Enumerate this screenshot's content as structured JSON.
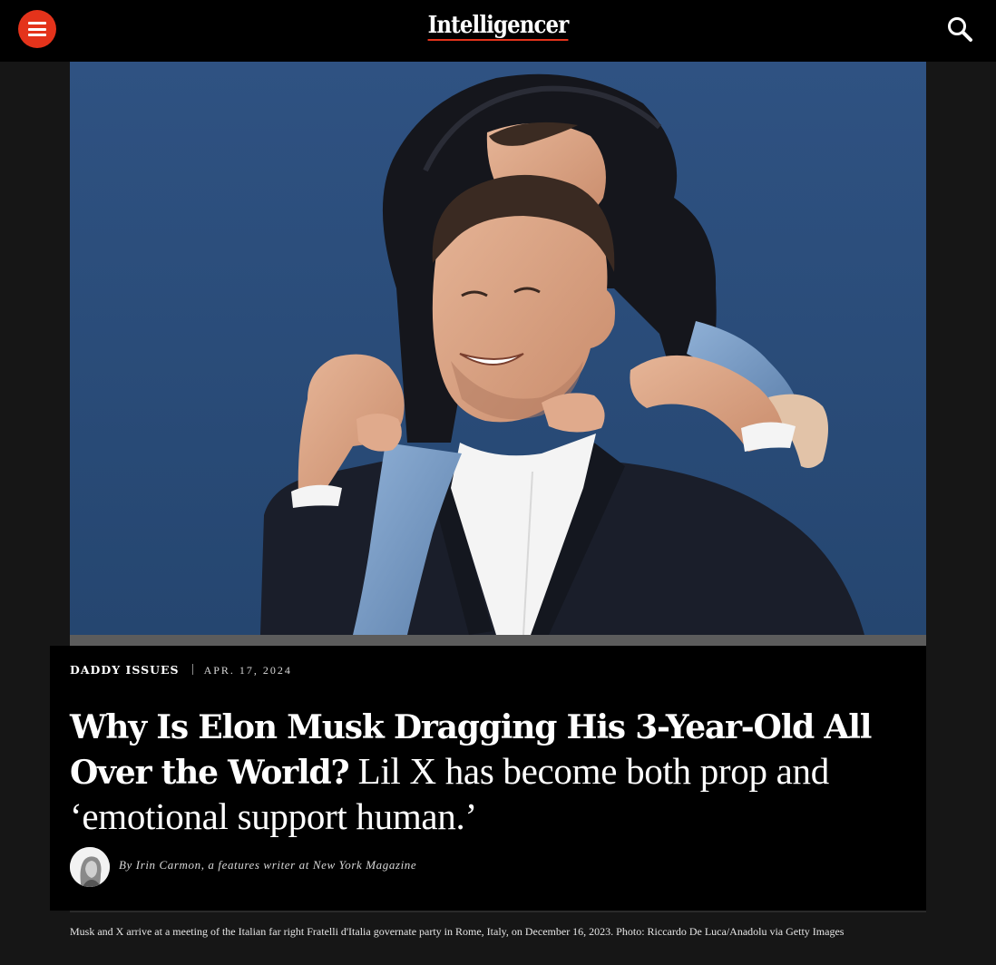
{
  "header": {
    "brand": "Intelligencer",
    "menu_icon": "hamburger-menu-icon",
    "search_icon": "search-icon",
    "accent_color": "#e4331b"
  },
  "hero": {
    "background_color": "#2c4c77"
  },
  "article": {
    "rubric": "DADDY ISSUES",
    "date": "APR. 17, 2024",
    "headline": "Why Is Elon Musk Dragging His 3-Year-Old All Over the World?",
    "dek": "Lil X has become both prop and ‘emotional support human.’",
    "byline": "By Irin Carmon, a features writer at New York Magazine"
  },
  "caption": "Musk and X arrive at a meeting of the Italian far right Fratelli d'Italia governate party in Rome, Italy, on December 16, 2023. Photo: Riccardo De Luca/Anadolu via Getty Images"
}
